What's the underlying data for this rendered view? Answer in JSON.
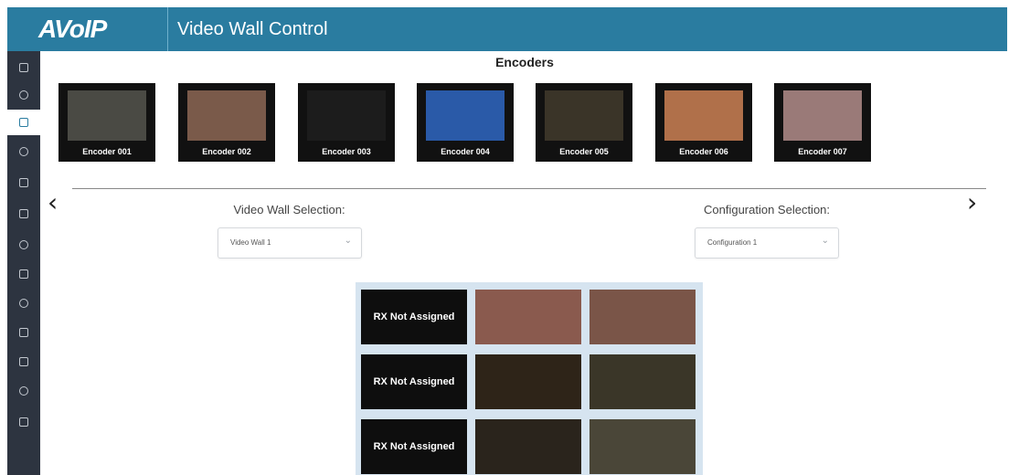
{
  "header": {
    "logo": "AVoIP",
    "title": "Video Wall Control"
  },
  "sidebar": {
    "items": [
      {
        "icon": "dashboard-icon",
        "active": false
      },
      {
        "icon": "settings-icon",
        "active": false
      },
      {
        "icon": "video-wall-icon",
        "active": true
      },
      {
        "icon": "layers-icon",
        "active": false
      },
      {
        "icon": "monitor-icon",
        "active": false
      },
      {
        "icon": "display-icon",
        "active": false
      },
      {
        "icon": "network-icon",
        "active": false
      },
      {
        "icon": "grid-icon",
        "active": false
      },
      {
        "icon": "user-icon",
        "active": false
      },
      {
        "icon": "sliders-icon",
        "active": false
      },
      {
        "icon": "upload-icon",
        "active": false
      },
      {
        "icon": "key-icon",
        "active": false
      },
      {
        "icon": "logout-icon",
        "active": false
      }
    ]
  },
  "encoders": {
    "heading": "Encoders",
    "items": [
      {
        "label": "Encoder 001",
        "color": "#4a4a44"
      },
      {
        "label": "Encoder 002",
        "color": "#7a5a4a"
      },
      {
        "label": "Encoder 003",
        "color": "#1c1c1c"
      },
      {
        "label": "Encoder 004",
        "color": "#2a5aa8"
      },
      {
        "label": "Encoder 005",
        "color": "#3a3428"
      },
      {
        "label": "Encoder 006",
        "color": "#b0704a"
      },
      {
        "label": "Encoder 007",
        "color": "#9a7a78"
      }
    ]
  },
  "selection": {
    "video_wall_label": "Video Wall Selection:",
    "video_wall_value": "Video Wall 1",
    "config_label": "Configuration Selection:",
    "config_value": "Configuration 1"
  },
  "wall": {
    "rows": [
      {
        "cells": [
          {
            "text": "RX Not Assigned",
            "color": "#0e0e0e"
          },
          {
            "text": "",
            "color": "#8a5a4e"
          },
          {
            "text": "",
            "color": "#7a5548"
          }
        ]
      },
      {
        "cells": [
          {
            "text": "RX Not Assigned",
            "color": "#0e0e0e"
          },
          {
            "text": "",
            "color": "#2e2418"
          },
          {
            "text": "",
            "color": "#3a3628"
          }
        ]
      },
      {
        "cells": [
          {
            "text": "RX Not Assigned",
            "color": "#0e0e0e"
          },
          {
            "text": "",
            "color": "#2a241c"
          },
          {
            "text": "",
            "color": "#4a4638"
          }
        ]
      }
    ]
  }
}
